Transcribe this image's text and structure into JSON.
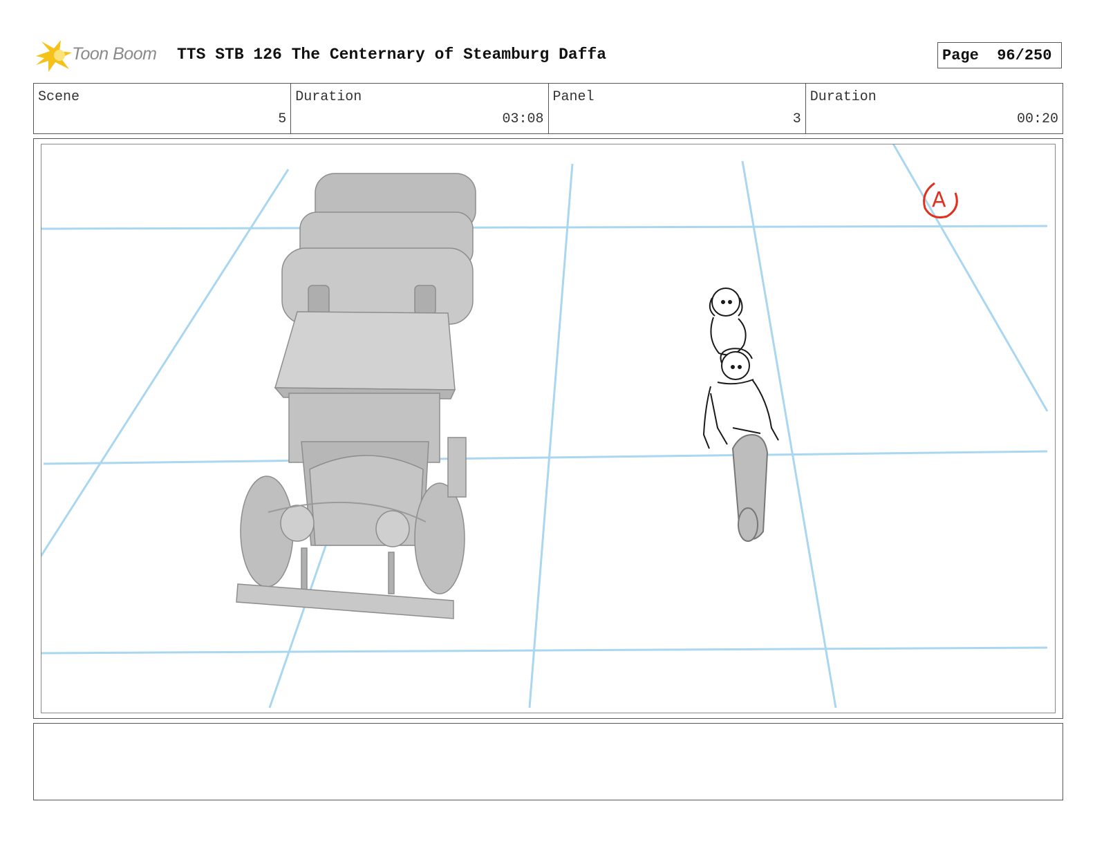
{
  "header": {
    "logo_text": "Toon Boom",
    "title": "TTS STB 126 The Centernary of Steamburg Daffa",
    "page_label": "Page",
    "page_value": "96/250"
  },
  "info": {
    "scene_label": "Scene",
    "scene_value": "5",
    "scene_duration_label": "Duration",
    "scene_duration_value": "03:08",
    "panel_label": "Panel",
    "panel_value": "3",
    "panel_duration_label": "Duration",
    "panel_duration_value": "00:20"
  },
  "panel": {
    "annotation": "A",
    "guide_color": "#a9d6f0",
    "annotation_color": "#e0301e"
  },
  "notes": {
    "text": ""
  }
}
